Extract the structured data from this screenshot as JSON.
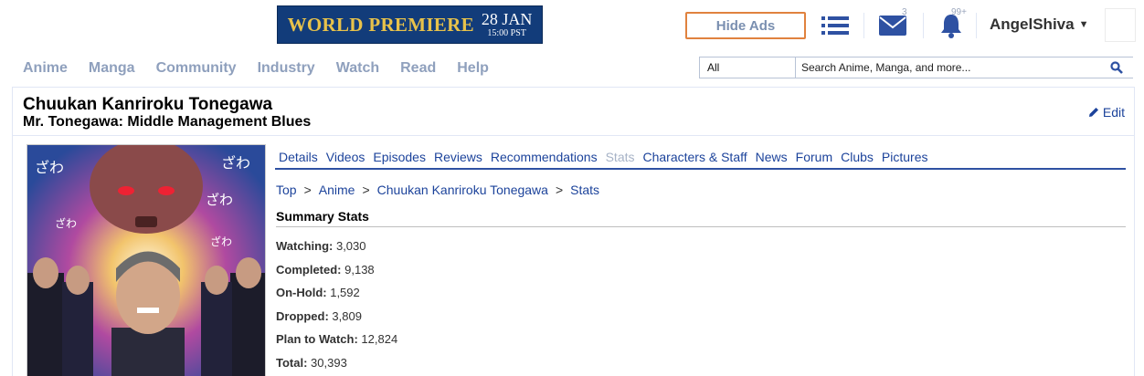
{
  "promo": {
    "headline": "WORLD PREMIERE",
    "date": "28 JAN",
    "time": "15:00 PST"
  },
  "header": {
    "hide_ads": "Hide Ads",
    "mail_count": "3",
    "notif_count": "99+",
    "username": "AngelShiva"
  },
  "nav": [
    "Anime",
    "Manga",
    "Community",
    "Industry",
    "Watch",
    "Read",
    "Help"
  ],
  "search": {
    "category": "All",
    "placeholder": "Search Anime, Manga, and more..."
  },
  "page": {
    "title": "Chuukan Kanriroku Tonegawa",
    "subtitle": "Mr. Tonegawa: Middle Management Blues",
    "edit": "Edit"
  },
  "tabs": [
    "Details",
    "Videos",
    "Episodes",
    "Reviews",
    "Recommendations",
    "Stats",
    "Characters & Staff",
    "News",
    "Forum",
    "Clubs",
    "Pictures"
  ],
  "active_tab": "Stats",
  "breadcrumb": [
    "Top",
    "Anime",
    "Chuukan Kanriroku Tonegawa",
    "Stats"
  ],
  "summary": {
    "heading": "Summary Stats",
    "rows": [
      {
        "label": "Watching:",
        "value": "3,030"
      },
      {
        "label": "Completed:",
        "value": "9,138"
      },
      {
        "label": "On-Hold:",
        "value": "1,592"
      },
      {
        "label": "Dropped:",
        "value": "3,809"
      },
      {
        "label": "Plan to Watch:",
        "value": "12,824"
      },
      {
        "label": "Total:",
        "value": "30,393"
      }
    ]
  },
  "colors": {
    "link": "#1c439b",
    "accent": "#2e51a2",
    "hide_ads_border": "#e0823e"
  }
}
